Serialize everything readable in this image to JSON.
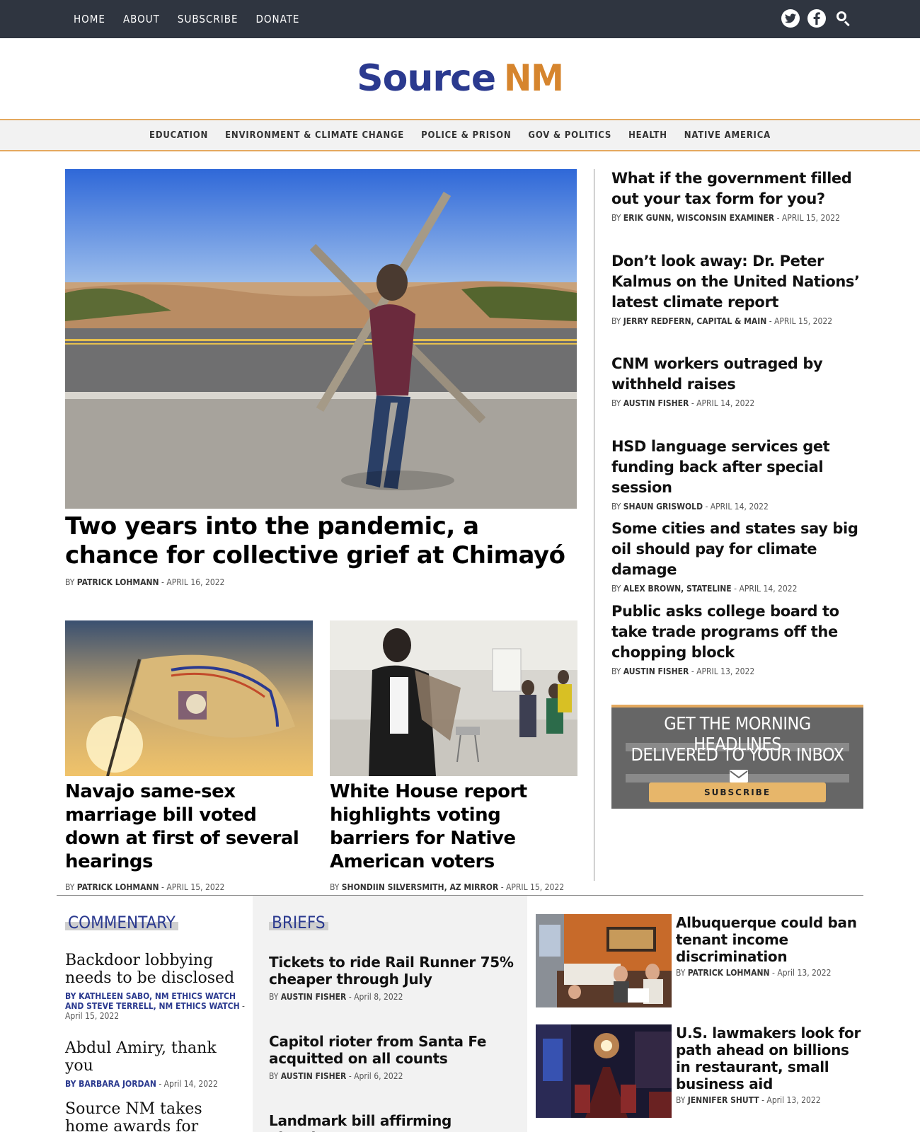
{
  "topnav": [
    "HOME",
    "ABOUT",
    "SUBSCRIBE",
    "DONATE"
  ],
  "social": {
    "twitter": "twitter-icon",
    "facebook": "facebook-icon",
    "search": "search-icon"
  },
  "logo": {
    "source": "Source",
    "nm": "NM"
  },
  "categories": [
    "EDUCATION",
    "ENVIRONMENT & CLIMATE CHANGE",
    "POLICE & PRISON",
    "GOV & POLITICS",
    "HEALTH",
    "NATIVE AMERICA"
  ],
  "hero": {
    "title": "Two years into the pandemic, a chance for collective grief at Chimayó",
    "by": "BY",
    "author": "PATRICK LOHMANN",
    "date": "- APRIL 16, 2022"
  },
  "cards": [
    {
      "title": "Navajo same-sex marriage bill voted down at first of several hearings",
      "by": "BY",
      "author": "PATRICK LOHMANN",
      "date": "- APRIL 15, 2022"
    },
    {
      "title": "White House report highlights voting barriers for Native American voters",
      "by": "BY",
      "author": "SHONDIIN SILVERSMITH, AZ MIRROR",
      "date": "- APRIL 15, 2022"
    }
  ],
  "right_stories": [
    {
      "title": "What if the government filled out your tax form for you?",
      "by": "BY",
      "author": "ERIK GUNN, WISCONSIN EXAMINER",
      "date": "- APRIL 15, 2022"
    },
    {
      "title": "Don’t look away: Dr. Peter Kalmus on the United Nations’ latest climate report",
      "by": "BY",
      "author": "JERRY REDFERN, CAPITAL & MAIN",
      "date": "- APRIL 15, 2022"
    },
    {
      "title": "CNM workers outraged by withheld raises",
      "by": "BY",
      "author": "AUSTIN FISHER",
      "date": "- APRIL 14, 2022"
    },
    {
      "title": "HSD language services get funding back after special session",
      "by": "BY",
      "author": "SHAUN GRISWOLD",
      "date": "- APRIL 14, 2022"
    },
    {
      "title": "Some cities and states say big oil should pay for climate damage",
      "by": "BY",
      "author": "ALEX BROWN, STATELINE",
      "date": "- APRIL 14, 2022"
    },
    {
      "title": "Public asks college board to take trade programs off the chopping block",
      "by": "BY",
      "author": "AUSTIN FISHER",
      "date": "- APRIL 13, 2022"
    }
  ],
  "signup": {
    "line1": "GET THE MORNING HEADLINES",
    "line2": "DELIVERED TO YOUR INBOX",
    "button": "SUBSCRIBE"
  },
  "commentary": {
    "heading": "COMMENTARY",
    "items": [
      {
        "title": "Backdoor lobbying needs to be disclosed",
        "author": "BY KATHLEEN SABO, NM ETHICS WATCH AND STEVE TERRELL, NM ETHICS WATCH",
        "date": "- April 15, 2022"
      },
      {
        "title": "Abdul Amiry, thank you",
        "author": "BY BARBARA JORDAN",
        "date": "- April 14, 2022"
      },
      {
        "title": "Source NM takes home awards for stories and",
        "author": "",
        "date": ""
      }
    ]
  },
  "briefs": {
    "heading": "BRIEFS",
    "items": [
      {
        "title": "Tickets to ride Rail Runner 75% cheaper through July",
        "by": "BY",
        "author": "AUSTIN FISHER",
        "date": "- April 8, 2022"
      },
      {
        "title": "Capitol rioter from Santa Fe acquitted on all counts",
        "by": "BY",
        "author": "AUSTIN FISHER",
        "date": "- April 6, 2022"
      },
      {
        "title": "Landmark bill affirming abortion",
        "by": "",
        "author": "",
        "date": ""
      }
    ]
  },
  "photo_stories": [
    {
      "title": "Albuquerque could ban tenant income discrimination",
      "by": "BY",
      "author": "PATRICK LOHMANN",
      "date": "- April 13, 2022"
    },
    {
      "title": "U.S. lawmakers look for path ahead on billions in restaurant, small business aid",
      "by": "BY",
      "author": "JENNIFER SHUTT",
      "date": "- April 13, 2022"
    }
  ],
  "colors": {
    "topbar": "#2f3540",
    "brand_blue": "#2b3a8f",
    "brand_orange": "#d6852e",
    "accent": "#e4a95f"
  }
}
